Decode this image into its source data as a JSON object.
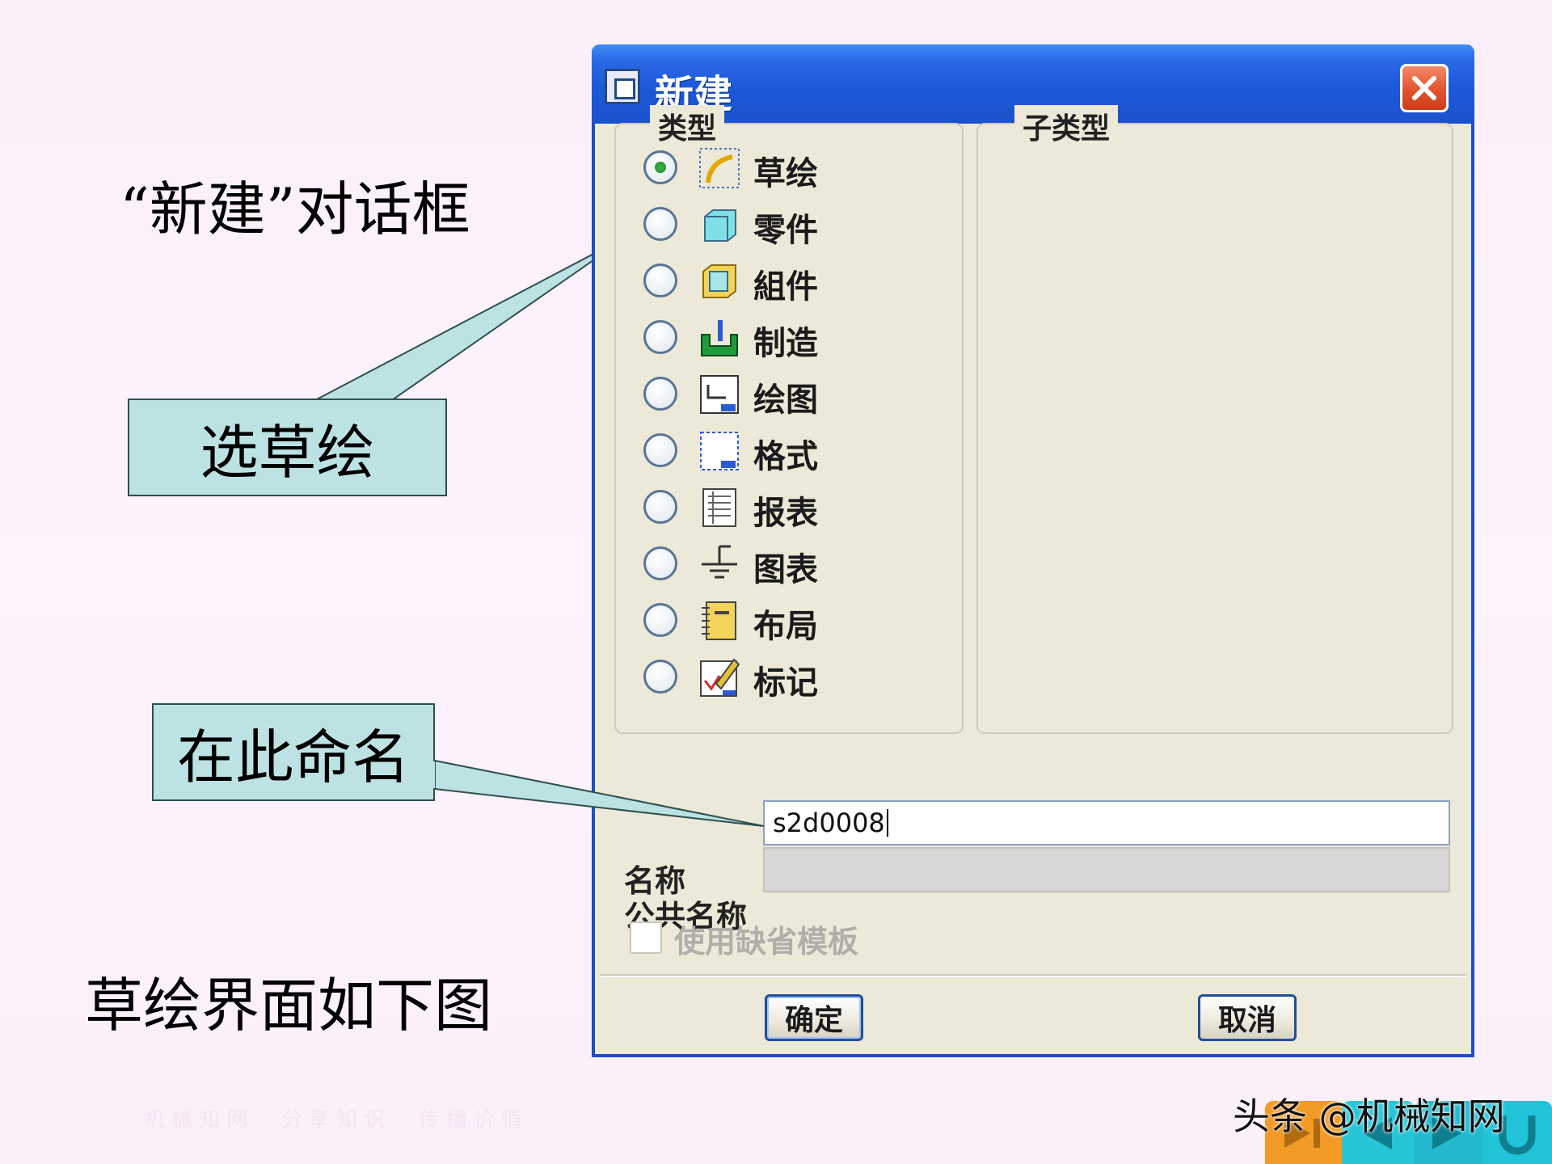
{
  "slide": {
    "heading": "“新建”对话框",
    "callout_sketch": "选草绘",
    "callout_name": "在此命名",
    "footer_text": "草绘界面如下图",
    "watermark_left": "机械知网　分享知识　传播价值",
    "watermark_right": "头条 @机械知网"
  },
  "dialog": {
    "title": "新建",
    "type_group_label": "类型",
    "subtype_group_label": "子类型",
    "types": [
      {
        "label": "草绘",
        "icon": "sketch-icon",
        "selected": true
      },
      {
        "label": "零件",
        "icon": "part-icon",
        "selected": false
      },
      {
        "label": "組件",
        "icon": "assembly-icon",
        "selected": false
      },
      {
        "label": "制造",
        "icon": "manufacturing-icon",
        "selected": false
      },
      {
        "label": "绘图",
        "icon": "drawing-icon",
        "selected": false
      },
      {
        "label": "格式",
        "icon": "format-icon",
        "selected": false
      },
      {
        "label": "报表",
        "icon": "report-icon",
        "selected": false
      },
      {
        "label": "图表",
        "icon": "diagram-icon",
        "selected": false
      },
      {
        "label": "布局",
        "icon": "layout-icon",
        "selected": false
      },
      {
        "label": "标记",
        "icon": "markup-icon",
        "selected": false
      }
    ],
    "name_label": "名称",
    "name_value": "s2d0008",
    "common_name_label": "公共名称",
    "common_name_value": "",
    "use_default_template_label": "使用缺省模板",
    "use_default_template_checked": false,
    "use_default_template_enabled": false,
    "ok_label": "确定",
    "cancel_label": "取消"
  },
  "colors": {
    "titlebar": "#2a68e6",
    "close_button": "#e2532d",
    "callout_fill": "#bde2e4",
    "dialog_face": "#ece9d8"
  }
}
